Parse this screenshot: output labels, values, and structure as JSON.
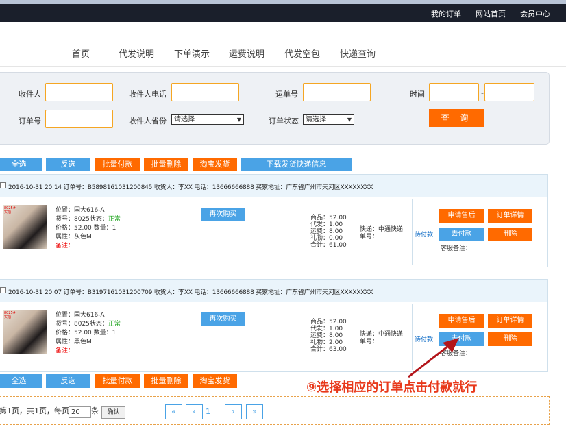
{
  "topbar": {
    "my_orders": "我的订单",
    "home": "网站首页",
    "member": "会员中心"
  },
  "nav": [
    "首页",
    "代发说明",
    "下单演示",
    "运费说明",
    "代发空包",
    "快递查询"
  ],
  "search": {
    "receiver_label": "收件人",
    "phone_label": "收件人电话",
    "waybill_label": "运单号",
    "time_label": "时间",
    "time_sep": "-",
    "order_no_label": "订单号",
    "province_label": "收件人省份",
    "province_value": "请选择",
    "status_label": "订单状态",
    "status_value": "请选择",
    "query_button": "查 询"
  },
  "actions": {
    "select_all": "全选",
    "invert": "反选",
    "batch_pay": "批量付款",
    "batch_delete": "批量删除",
    "taobao_ship": "淘宝发货",
    "download_ship": "下载发货快递信息"
  },
  "orders": [
    {
      "header": "2016-10-31 20:14  订单号：B5898161031200845 收货人：李XX 电话：13666666888 买家地址：广东省广州市天河区XXXXXXXX",
      "thumb_tag": "8025#\n实拍",
      "location": "位置：国大616-A",
      "item_prefix": "货号：8025状态：",
      "item_status": "正常",
      "price": "价格：52.00   数量：1",
      "attr": "属性：灰色M",
      "note": "备注：",
      "rebuy": "再次购买",
      "money": "商品：52.00\n代发：1.00\n运费：8.00\n礼物：0.00\n合计：61.00",
      "ship": "快递：中通快递\n单号：",
      "pay_status": "待付款",
      "btn_aftersale": "申请售后",
      "btn_detail": "订单详情",
      "btn_pay": "去付款",
      "btn_delete": "删除",
      "remark": "客服备注："
    },
    {
      "header": "2016-10-31 20:07  订单号：B3197161031200709 收货人：李XX 电话：13666666888 买家地址：广东省广州市天河区XXXXXXXX",
      "thumb_tag": "8025#\n实拍",
      "location": "位置：国大616-A",
      "item_prefix": "货号：8025状态：",
      "item_status": "正常",
      "price": "价格：52.00   数量：1",
      "attr": "属性：黑色M",
      "note": "备注：",
      "rebuy": "再次购买",
      "money": "商品：52.00\n代发：1.00\n运费：8.00\n礼物：2.00\n合计：63.00",
      "ship": "快递：中通快递\n单号：",
      "pay_status": "待付款",
      "btn_aftersale": "申请售后",
      "btn_detail": "订单详情",
      "btn_pay": "去付款",
      "btn_delete": "删除",
      "remark": "客服备注："
    }
  ],
  "annotation": "⑨选择相应的订单点击付款就行",
  "pager": {
    "info": "第1页，共1页，每页",
    "per_page": "20",
    "unit": "条",
    "ok": "确认",
    "first": "«",
    "prev": "‹",
    "current": "1",
    "next": "›",
    "last": "»"
  },
  "colors": {
    "accent_orange": "#ff6a00",
    "accent_blue": "#4aa3e6",
    "topbar": "#1a1f2b",
    "annotation": "#e8381a"
  }
}
